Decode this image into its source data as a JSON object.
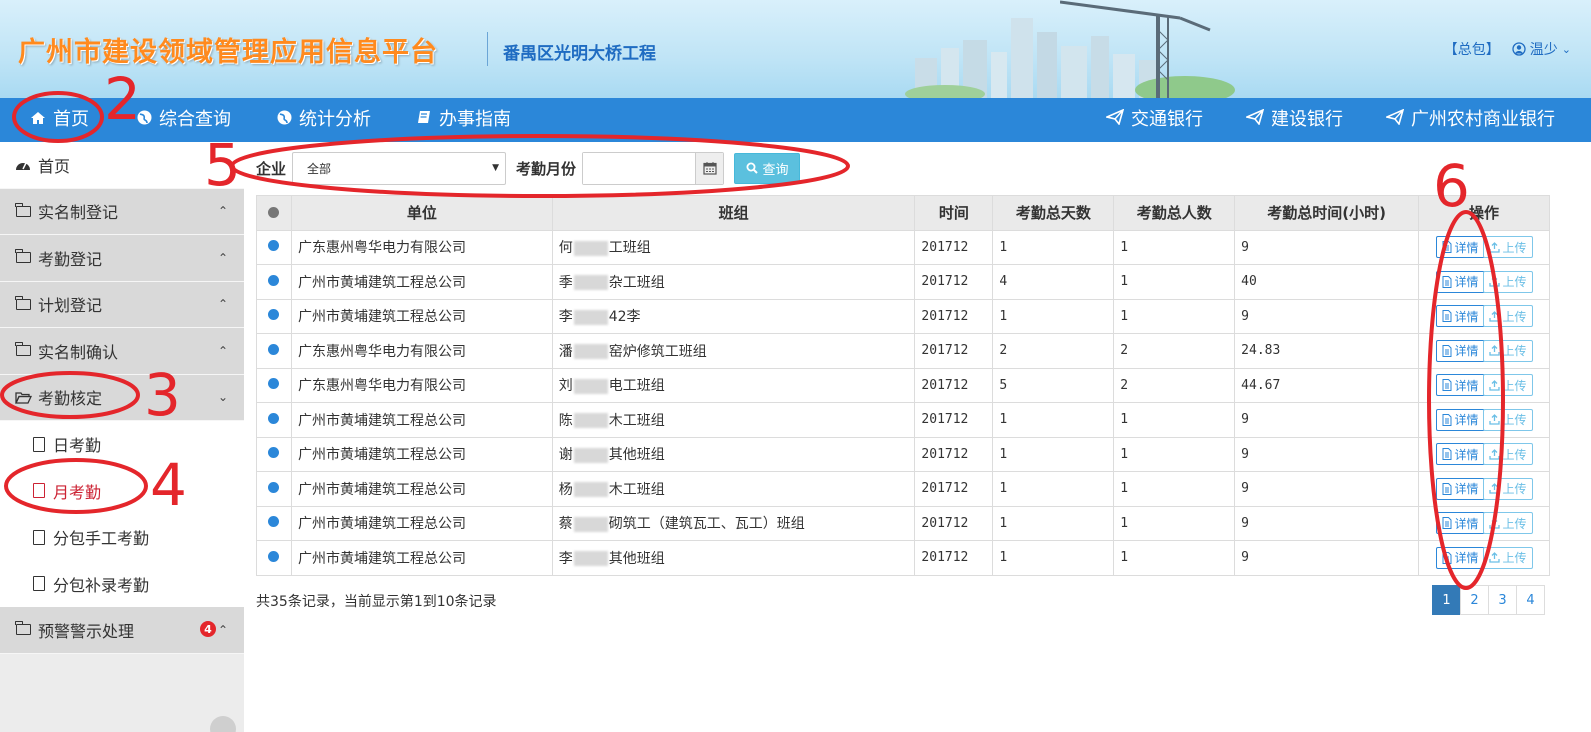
{
  "header": {
    "app_title": "广州市建设领域管理应用信息平台",
    "project_name": "番禺区光明大桥工程",
    "company_tag": "【总包】",
    "user_name": "温少"
  },
  "nav": {
    "items": [
      {
        "label": "首页",
        "icon": "home-icon"
      },
      {
        "label": "综合查询",
        "icon": "globe-icon"
      },
      {
        "label": "统计分析",
        "icon": "globe-icon"
      },
      {
        "label": "办事指南",
        "icon": "book-icon"
      }
    ],
    "banks": [
      {
        "label": "交通银行",
        "icon": "send-icon"
      },
      {
        "label": "建设银行",
        "icon": "send-icon"
      },
      {
        "label": "广州农村商业银行",
        "icon": "send-icon"
      }
    ]
  },
  "sidebar": {
    "home": "首页",
    "groups": [
      {
        "label": "实名制登记"
      },
      {
        "label": "考勤登记"
      },
      {
        "label": "计划登记"
      },
      {
        "label": "实名制确认"
      },
      {
        "label": "考勤核定"
      }
    ],
    "subs": [
      {
        "label": "日考勤"
      },
      {
        "label": "月考勤"
      },
      {
        "label": "分包手工考勤"
      },
      {
        "label": "分包补录考勤"
      }
    ],
    "warning": {
      "label": "预警警示处理",
      "badge": "4"
    }
  },
  "filter": {
    "company_label": "企业",
    "company_value": "全部",
    "month_label": "考勤月份",
    "month_value": "",
    "search_label": "查询"
  },
  "table": {
    "headers": [
      "单位",
      "班组",
      "时间",
      "考勤总天数",
      "考勤总人数",
      "考勤总时间(小时)",
      "操作"
    ],
    "detail_label": "详情",
    "upload_label": "上传",
    "rows": [
      {
        "unit": "广东惠州粤华电力有限公司",
        "team_a": "何",
        "team_b": "工班组",
        "time": "201712",
        "days": "1",
        "people": "1",
        "hours": "9"
      },
      {
        "unit": "广州市黄埔建筑工程总公司",
        "team_a": "季",
        "team_b": "杂工班组",
        "time": "201712",
        "days": "4",
        "people": "1",
        "hours": "40"
      },
      {
        "unit": "广州市黄埔建筑工程总公司",
        "team_a": "李",
        "team_b": "42李",
        "time": "201712",
        "days": "1",
        "people": "1",
        "hours": "9"
      },
      {
        "unit": "广东惠州粤华电力有限公司",
        "team_a": "潘",
        "team_b": "窑炉修筑工班组",
        "time": "201712",
        "days": "2",
        "people": "2",
        "hours": "24.83"
      },
      {
        "unit": "广东惠州粤华电力有限公司",
        "team_a": "刘",
        "team_b": "电工班组",
        "time": "201712",
        "days": "5",
        "people": "2",
        "hours": "44.67"
      },
      {
        "unit": "广州市黄埔建筑工程总公司",
        "team_a": "陈",
        "team_b": "木工班组",
        "time": "201712",
        "days": "1",
        "people": "1",
        "hours": "9"
      },
      {
        "unit": "广州市黄埔建筑工程总公司",
        "team_a": "谢",
        "team_b": "其他班组",
        "time": "201712",
        "days": "1",
        "people": "1",
        "hours": "9"
      },
      {
        "unit": "广州市黄埔建筑工程总公司",
        "team_a": "杨",
        "team_b": "木工班组",
        "time": "201712",
        "days": "1",
        "people": "1",
        "hours": "9"
      },
      {
        "unit": "广州市黄埔建筑工程总公司",
        "team_a": "蔡",
        "team_b": "砌筑工（建筑瓦工、瓦工）班组",
        "time": "201712",
        "days": "1",
        "people": "1",
        "hours": "9"
      },
      {
        "unit": "广州市黄埔建筑工程总公司",
        "team_a": "李",
        "team_b": "其他班组",
        "time": "201712",
        "days": "1",
        "people": "1",
        "hours": "9"
      }
    ]
  },
  "footer": {
    "record_info": "共35条记录，当前显示第1到10条记录",
    "pages": [
      "1",
      "2",
      "3",
      "4"
    ],
    "current_page": "1"
  },
  "annotations": {
    "numbers": [
      "2",
      "3",
      "4",
      "5",
      "6"
    ],
    "color": "#e4262b"
  },
  "colors": {
    "nav_bg": "#2b87d9",
    "title": "#ff8a1e",
    "project": "#1f6cc2",
    "accent": "#2b87d9",
    "search_btn": "#5bc0de",
    "annotation": "#e4262b"
  }
}
